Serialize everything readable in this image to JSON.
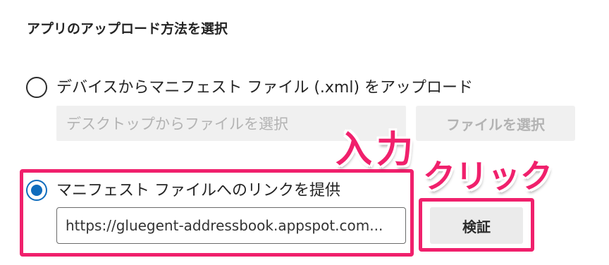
{
  "heading": "アプリのアップロード方法を選択",
  "option_device": {
    "label": "デバイスからマニフェスト ファイル (.xml) をアップロード",
    "selected": false,
    "file_input_placeholder": "デスクトップからファイルを選択",
    "choose_file_button": "ファイルを選択"
  },
  "option_link": {
    "label": "マニフェスト ファイルへのリンクを提供",
    "selected": true,
    "url_value": "https://gluegent-addressbook.appspot.com..."
  },
  "verify_button": "検証",
  "annotations": {
    "input_callout": "入力",
    "click_callout": "クリック",
    "highlight_color": "#f0206c"
  },
  "accent_color": "#0f6cbd"
}
